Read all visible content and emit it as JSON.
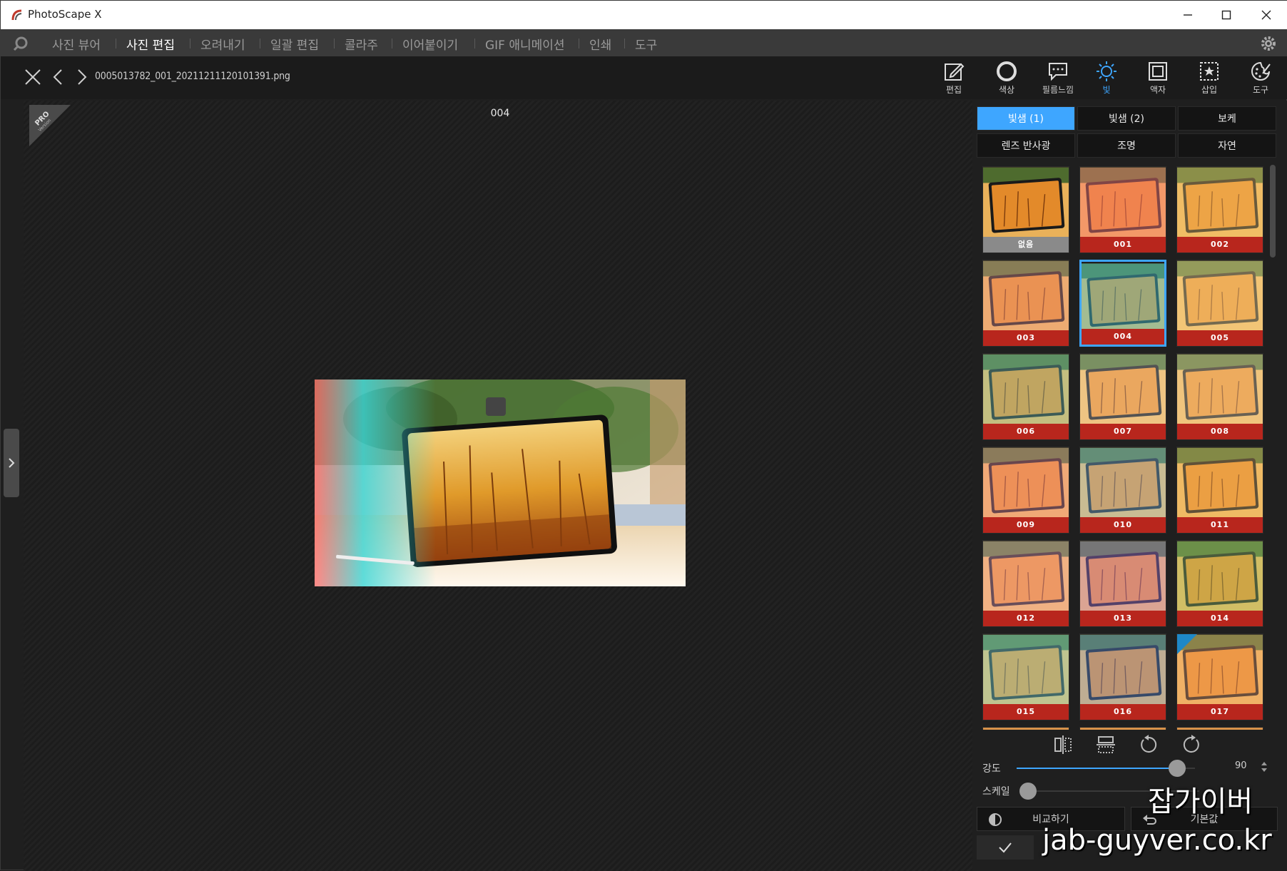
{
  "window": {
    "title": "PhotoScape X"
  },
  "menu": {
    "items": [
      {
        "label": "사진 뷰어",
        "active": false
      },
      {
        "label": "사진 편집",
        "active": true
      },
      {
        "label": "오려내기",
        "active": false
      },
      {
        "label": "일괄 편집",
        "active": false
      },
      {
        "label": "콜라주",
        "active": false
      },
      {
        "label": "이어붙이기",
        "active": false
      },
      {
        "label": "GIF 애니메이션",
        "active": false
      },
      {
        "label": "인쇄",
        "active": false
      },
      {
        "label": "도구",
        "active": false
      }
    ]
  },
  "toolbar": {
    "filename": "0005013782_001_20211211120101391.png",
    "tools": [
      {
        "label": "편집",
        "icon": "edit-icon"
      },
      {
        "label": "색상",
        "icon": "color-icon"
      },
      {
        "label": "필름느낌",
        "icon": "film-icon"
      },
      {
        "label": "빛",
        "icon": "light-icon",
        "active": true
      },
      {
        "label": "액자",
        "icon": "frame-icon"
      },
      {
        "label": "삽입",
        "icon": "insert-icon"
      },
      {
        "label": "도구",
        "icon": "tools-icon"
      }
    ]
  },
  "canvas": {
    "effect_label": "004",
    "pro_badge_top": "PRO",
    "pro_badge_bottom": "Version"
  },
  "panel": {
    "tabs_row1": [
      {
        "label": "빛샘 (1)",
        "active": true
      },
      {
        "label": "빛샘 (2)",
        "active": false
      },
      {
        "label": "보케",
        "active": false
      }
    ],
    "tabs_row2": [
      {
        "label": "렌즈 반사광",
        "active": false
      },
      {
        "label": "조명",
        "active": false
      },
      {
        "label": "자연",
        "active": false
      }
    ],
    "thumbs": [
      "없음",
      "001",
      "002",
      "003",
      "004",
      "005",
      "006",
      "007",
      "008",
      "009",
      "010",
      "011",
      "012",
      "013",
      "014",
      "015",
      "016",
      "017"
    ],
    "selected_thumb": "004",
    "pro_thumb": "017",
    "strength": {
      "label": "강도",
      "value": "90",
      "fraction": 0.9
    },
    "scale": {
      "label": "스케일",
      "fraction": 0.0
    },
    "compare_label": "비교하기",
    "default_label": "기본값"
  },
  "watermark": {
    "line1": "잡가이버",
    "line2": "jab-guyver.co.kr"
  },
  "colors": {
    "accent": "#3ea6ff",
    "caption_red": "#b8261d",
    "bg": "#1f1f1f"
  }
}
